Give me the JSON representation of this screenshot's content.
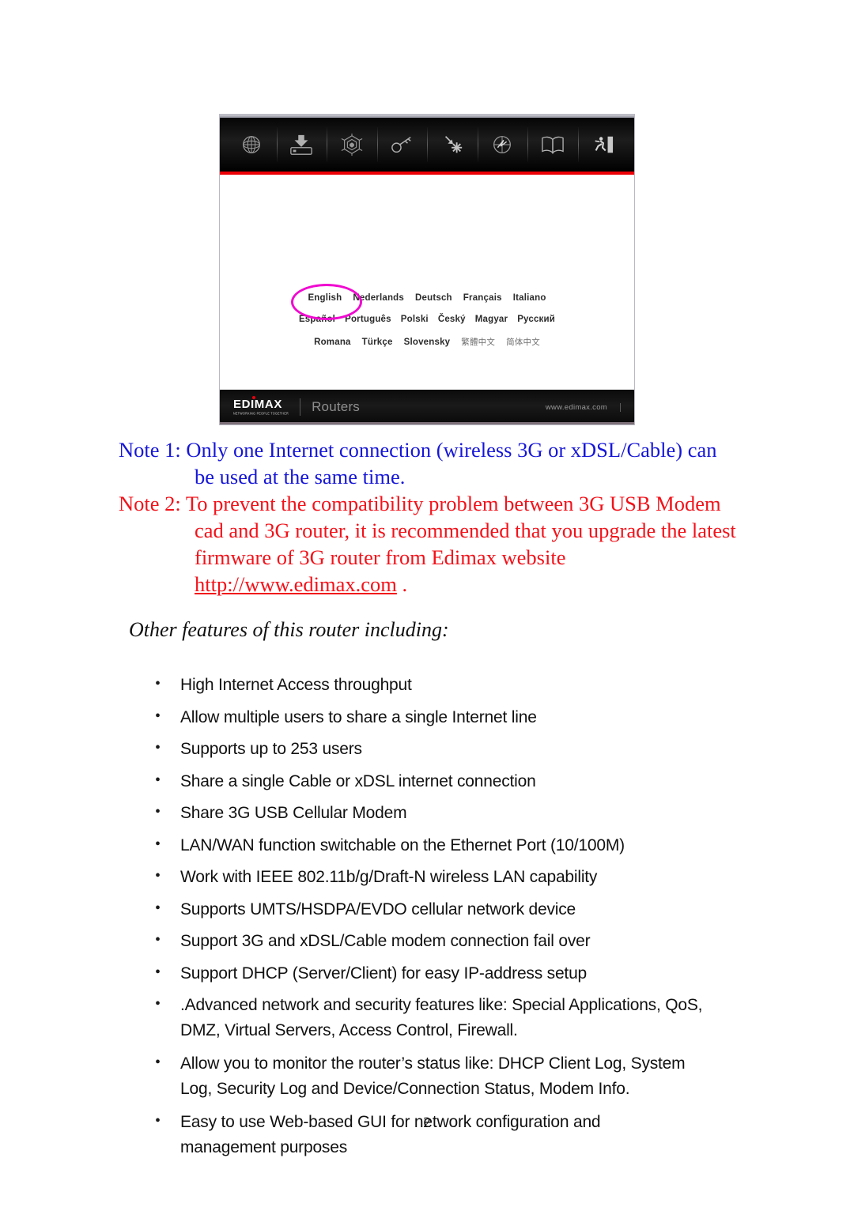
{
  "router_ui": {
    "toolbar_icons": [
      "globe-icon",
      "save-to-device-icon",
      "wireless-web-icon",
      "key-icon",
      "nat-forward-icon",
      "qos-compass-icon",
      "manual-book-icon",
      "logout-exit-icon"
    ],
    "language_rows": [
      [
        "English",
        "Nederlands",
        "Deutsch",
        "Français",
        "Italiano"
      ],
      [
        "Español",
        "Português",
        "Polski",
        "Český",
        "Magyar",
        "Русский"
      ],
      [
        "Romana",
        "Türkçe",
        "Slovensky",
        "繁體中文",
        "简体中文"
      ]
    ],
    "selected_language": "English",
    "highlight_color": "#f009d0",
    "accent_rule_color": "#ec0006",
    "footer": {
      "brand": "EDIMAX",
      "brand_tagline": "NETWORKING PEOPLE TOGETHER",
      "product": "Routers",
      "url": "www.edimax.com"
    }
  },
  "notes": {
    "note1": {
      "color": "#1616d8",
      "lines": [
        "Note 1: Only one Internet connection (wireless 3G or xDSL/Cable) can",
        "be used at the same time."
      ]
    },
    "note2": {
      "color": "#f2121a",
      "lines": [
        "Note 2: To prevent the compatibility problem between 3G USB Modem",
        "cad and 3G router, it is recommended that you upgrade the latest",
        "firmware of 3G router from Edimax website"
      ],
      "url": "http://www.edimax.com",
      "url_suffix": " ."
    }
  },
  "section": {
    "heading": "Other features of this router including:"
  },
  "features": {
    "bullet_glyph": "•",
    "items": [
      {
        "lines": [
          "High Internet Access throughput"
        ]
      },
      {
        "lines": [
          "Allow multiple users to share a single Internet line"
        ]
      },
      {
        "lines": [
          "Supports up to 253 users"
        ]
      },
      {
        "lines": [
          "Share a single Cable or xDSL internet connection"
        ]
      },
      {
        "lines": [
          "Share 3G USB Cellular Modem"
        ]
      },
      {
        "lines": [
          "LAN/WAN function switchable on the Ethernet Port (10/100M)"
        ]
      },
      {
        "lines": [
          "Work with IEEE 802.11b/g/Draft-N wireless LAN capability"
        ]
      },
      {
        "lines": [
          "Supports UMTS/HSDPA/EVDO cellular network device"
        ]
      },
      {
        "lines": [
          "Support 3G and xDSL/Cable modem connection fail over"
        ]
      },
      {
        "lines": [
          "Support DHCP (Server/Client) for easy IP-address setup"
        ]
      },
      {
        "lines": [
          ".Advanced network and security features like: Special Applications, QoS,",
          "DMZ, Virtual Servers, Access Control, Firewall."
        ]
      },
      {
        "lines": [
          "Allow you to monitor the router’s status like: DHCP Client Log, System",
          "Log, Security Log and Device/Connection Status, Modem Info."
        ]
      },
      {
        "lines": [
          "Easy to use Web-based GUI for network configuration and",
          "management purposes"
        ]
      }
    ]
  },
  "page": {
    "number": "2"
  }
}
